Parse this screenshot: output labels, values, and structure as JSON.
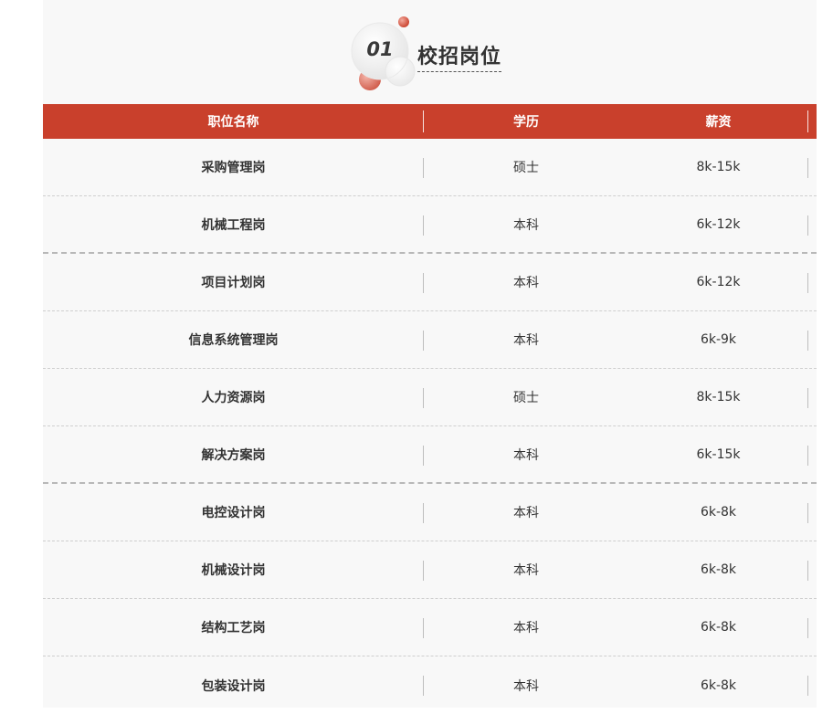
{
  "section": {
    "number": "01",
    "title": "校招岗位",
    "accent_color": "#c9402c"
  },
  "table": {
    "headers": [
      "职位名称",
      "学历",
      "薪资"
    ],
    "rows": [
      {
        "position": "采购管理岗",
        "education": "硕士",
        "salary": "8k-15k"
      },
      {
        "position": "机械工程岗",
        "education": "本科",
        "salary": "6k-12k"
      },
      {
        "position": "项目计划岗",
        "education": "本科",
        "salary": "6k-12k"
      },
      {
        "position": "信息系统管理岗",
        "education": "本科",
        "salary": "6k-9k"
      },
      {
        "position": "人力资源岗",
        "education": "硕士",
        "salary": "8k-15k"
      },
      {
        "position": "解决方案岗",
        "education": "本科",
        "salary": "6k-15k"
      },
      {
        "position": "电控设计岗",
        "education": "本科",
        "salary": "6k-8k"
      },
      {
        "position": "机械设计岗",
        "education": "本科",
        "salary": "6k-8k"
      },
      {
        "position": "结构工艺岗",
        "education": "本科",
        "salary": "6k-8k"
      },
      {
        "position": "包装设计岗",
        "education": "本科",
        "salary": "6k-8k"
      }
    ]
  }
}
